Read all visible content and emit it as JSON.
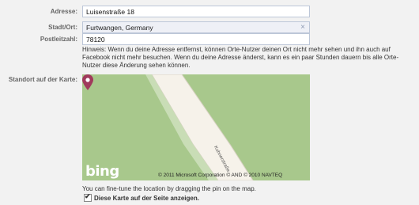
{
  "form": {
    "address_label": "Adresse:",
    "address_value": "Luisenstraße 18",
    "city_label": "Stadt/Ort:",
    "city_value": "Furtwangen, Germany",
    "postal_label": "Postleitzahl:",
    "postal_value": "78120",
    "hint": "Hinweis: Wenn du deine Adresse entfernst, können Orte-Nutzer deinen Ort nicht mehr sehen und ihn auch auf Facebook nicht mehr besuchen. Wenn du deine Adresse änderst, kann es ein paar Stunden dauern bis alle Orte-Nutzer diese Änderung sehen können.",
    "map_label": "Standort auf der Karte:"
  },
  "map": {
    "logo": "bing",
    "copyright": "© 2011 Microsoft Corporation  © AND  © 2010 NAVTEQ",
    "street_label": "Kuhnerstraße",
    "pin_color": "#a03a5c",
    "land_color": "#a8c88c",
    "road_color": "#f6f2ea"
  },
  "footer": {
    "fine_tune": "You can fine-tune the location by dragging the pin on the map.",
    "show_on_page": "Diese Karte auf der Seite anzeigen.",
    "show_on_page_checked": true
  },
  "icons": {
    "clear": "close-icon",
    "pin": "map-pin-icon",
    "checkbox": "checkmark-icon"
  }
}
